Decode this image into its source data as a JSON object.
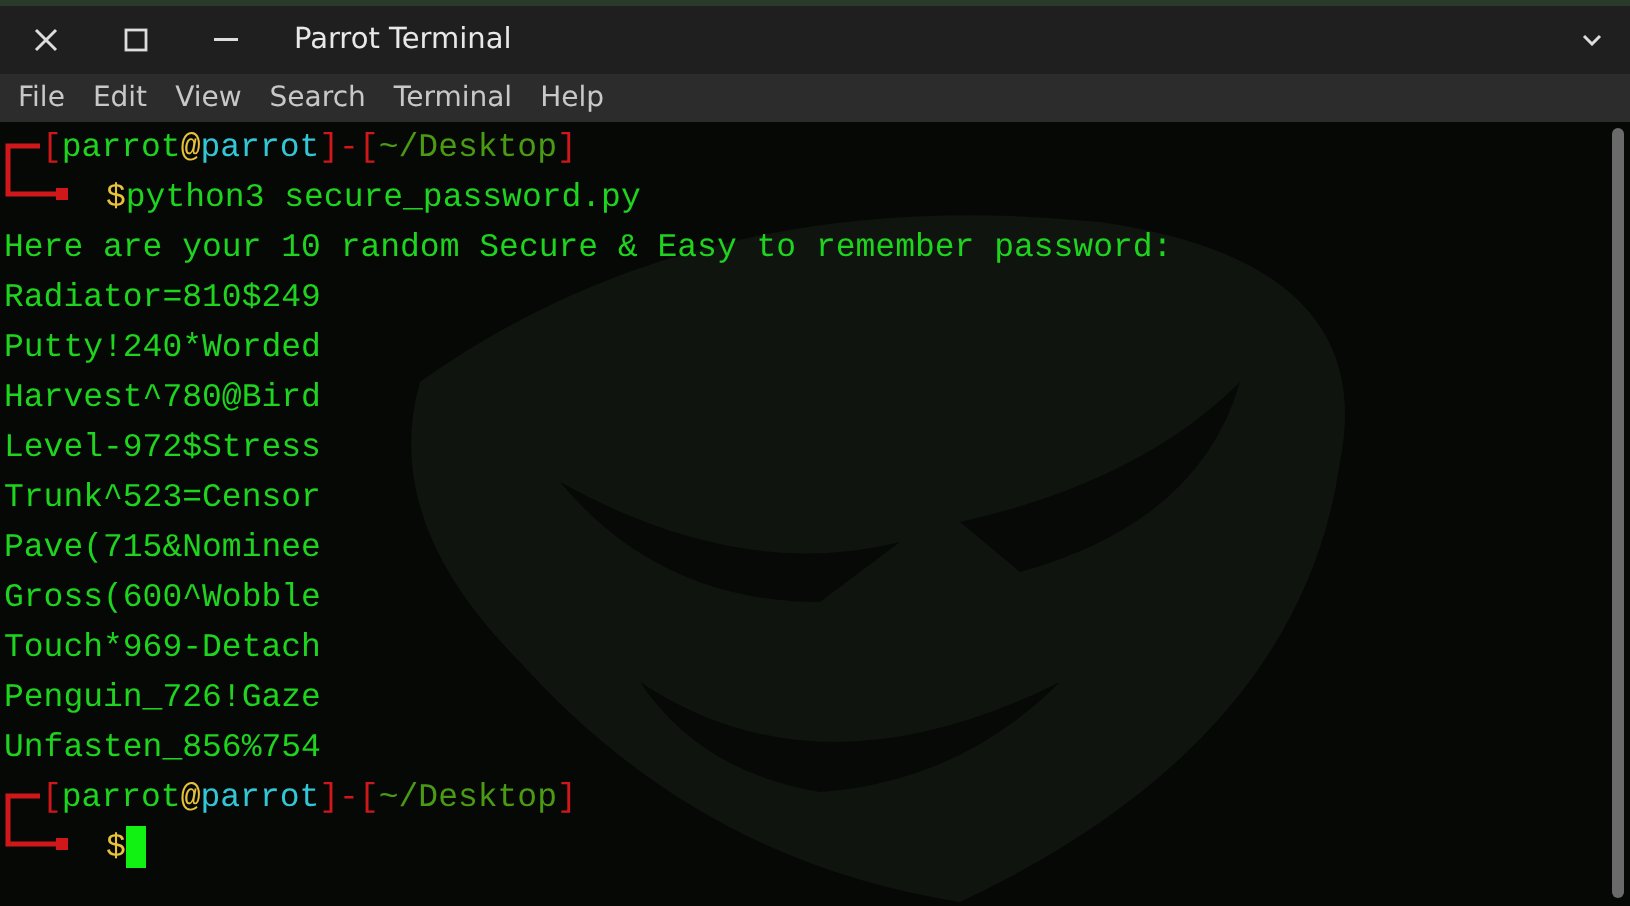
{
  "window": {
    "title": "Parrot Terminal"
  },
  "menu": [
    "File",
    "Edit",
    "View",
    "Search",
    "Terminal",
    "Help"
  ],
  "blocks": [
    {
      "prompt": [
        {
          "kind": "bracket",
          "text": "["
        },
        {
          "kind": "user",
          "text": "parrot"
        },
        {
          "kind": "at",
          "text": "@"
        },
        {
          "kind": "host",
          "text": "parrot"
        },
        {
          "kind": "bracket",
          "text": "]-["
        },
        {
          "kind": "dir",
          "text": "~/Desktop"
        },
        {
          "kind": "bracket",
          "text": "]"
        }
      ],
      "sign": "$",
      "command": "python3 secure_password.py",
      "cursor": false,
      "output": [
        "Here are your 10 random Secure & Easy to remember password:",
        "Radiator=810$249",
        "Putty!240*Worded",
        "Harvest^780@Bird",
        "Level-972$Stress",
        "Trunk^523=Censor",
        "Pave(715&Nominee",
        "Gross(600^Wobble",
        "Touch*969-Detach",
        "Penguin_726!Gaze",
        "Unfasten_856%754"
      ]
    },
    {
      "prompt": [
        {
          "kind": "bracket",
          "text": "["
        },
        {
          "kind": "user",
          "text": "parrot"
        },
        {
          "kind": "at",
          "text": "@"
        },
        {
          "kind": "host",
          "text": "parrot"
        },
        {
          "kind": "bracket",
          "text": "]-["
        },
        {
          "kind": "dir",
          "text": "~/Desktop"
        },
        {
          "kind": "bracket",
          "text": "]"
        }
      ],
      "sign": "$",
      "cursor": true
    }
  ]
}
